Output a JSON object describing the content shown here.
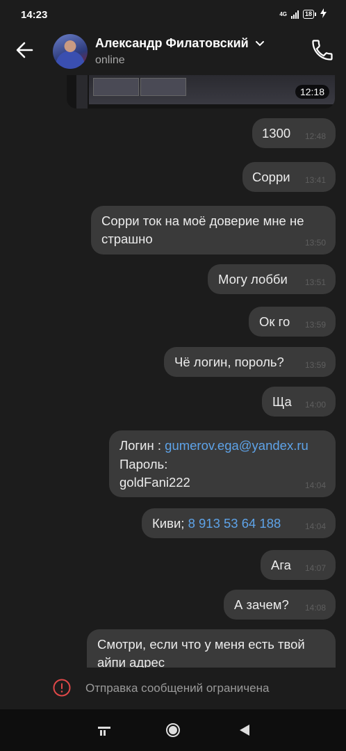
{
  "status": {
    "time": "14:23",
    "network": "4G",
    "battery": "18"
  },
  "header": {
    "name": "Александр Филатовский",
    "status": "online"
  },
  "preview": {
    "time": "12:18"
  },
  "messages": [
    {
      "text": "1300",
      "time": "12:48"
    },
    {
      "text": "Сорри",
      "time": "13:41"
    },
    {
      "text": "Сорри ток на моё доверие мне не\nстрашно",
      "time": "13:50"
    },
    {
      "text": "Могу лобби",
      "time": "13:51"
    },
    {
      "text": "Ок го",
      "time": "13:59"
    },
    {
      "text": "Чё логин, пороль?",
      "time": "13:59"
    },
    {
      "text": "Ща",
      "time": "14:00"
    },
    {
      "login_label": "Логин : ",
      "login_value": "gumerov.ega@yandex.ru",
      "password_label": "Пароль:",
      "password_value": "goldFani222",
      "time": "14:04"
    },
    {
      "prefix": "Киви; ",
      "phone": "8 913 53 64 188",
      "time": "14:04"
    },
    {
      "text": "Ага",
      "time": "14:07"
    },
    {
      "text": "А зачем?",
      "time": "14:08"
    },
    {
      "text": "Смотри, если что у меня есть твой\nайпи адрес"
    }
  ],
  "restriction": {
    "text": "Отправка сообщений ограничена"
  },
  "colors": {
    "background": "#1c1c1c",
    "bubble": "#3a3a3a",
    "link": "#5ea3e8",
    "error": "#e04848"
  },
  "icons": {
    "back": "arrow-left-icon",
    "call": "phone-icon",
    "alert": "alert-circle-icon"
  }
}
